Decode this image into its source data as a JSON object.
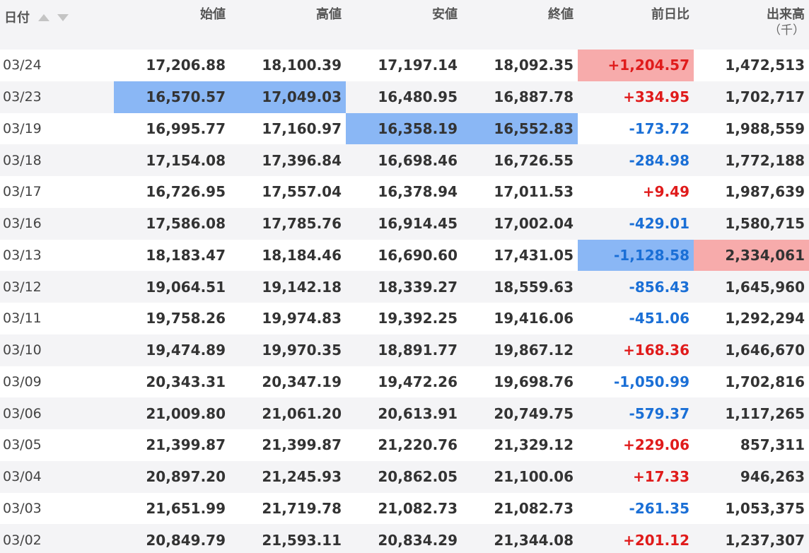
{
  "header": {
    "date": "日付",
    "open": "始値",
    "high": "高値",
    "low": "安値",
    "close": "終値",
    "change": "前日比",
    "volume": "出来高",
    "volume_unit": "（千）"
  },
  "colors": {
    "up": "#e01b1b",
    "down": "#1a6fd6",
    "highlight_blue": "#8ab7f5",
    "highlight_red": "#f7abab",
    "row_alt": "#f4f4f6"
  },
  "rows": [
    {
      "date": "03/24",
      "open": "17,206.88",
      "high": "18,100.39",
      "low": "17,197.14",
      "close": "18,092.35",
      "change": "+1,204.57",
      "volume": "1,472,513"
    },
    {
      "date": "03/23",
      "open": "16,570.57",
      "high": "17,049.03",
      "low": "16,480.95",
      "close": "16,887.78",
      "change": "+334.95",
      "volume": "1,702,717"
    },
    {
      "date": "03/19",
      "open": "16,995.77",
      "high": "17,160.97",
      "low": "16,358.19",
      "close": "16,552.83",
      "change": "-173.72",
      "volume": "1,988,559"
    },
    {
      "date": "03/18",
      "open": "17,154.08",
      "high": "17,396.84",
      "low": "16,698.46",
      "close": "16,726.55",
      "change": "-284.98",
      "volume": "1,772,188"
    },
    {
      "date": "03/17",
      "open": "16,726.95",
      "high": "17,557.04",
      "low": "16,378.94",
      "close": "17,011.53",
      "change": "+9.49",
      "volume": "1,987,639"
    },
    {
      "date": "03/16",
      "open": "17,586.08",
      "high": "17,785.76",
      "low": "16,914.45",
      "close": "17,002.04",
      "change": "-429.01",
      "volume": "1,580,715"
    },
    {
      "date": "03/13",
      "open": "18,183.47",
      "high": "18,184.46",
      "low": "16,690.60",
      "close": "17,431.05",
      "change": "-1,128.58",
      "volume": "2,334,061"
    },
    {
      "date": "03/12",
      "open": "19,064.51",
      "high": "19,142.18",
      "low": "18,339.27",
      "close": "18,559.63",
      "change": "-856.43",
      "volume": "1,645,960"
    },
    {
      "date": "03/11",
      "open": "19,758.26",
      "high": "19,974.83",
      "low": "19,392.25",
      "close": "19,416.06",
      "change": "-451.06",
      "volume": "1,292,294"
    },
    {
      "date": "03/10",
      "open": "19,474.89",
      "high": "19,970.35",
      "low": "18,891.77",
      "close": "19,867.12",
      "change": "+168.36",
      "volume": "1,646,670"
    },
    {
      "date": "03/09",
      "open": "20,343.31",
      "high": "20,347.19",
      "low": "19,472.26",
      "close": "19,698.76",
      "change": "-1,050.99",
      "volume": "1,702,816"
    },
    {
      "date": "03/06",
      "open": "21,009.80",
      "high": "21,061.20",
      "low": "20,613.91",
      "close": "20,749.75",
      "change": "-579.37",
      "volume": "1,117,265"
    },
    {
      "date": "03/05",
      "open": "21,399.87",
      "high": "21,399.87",
      "low": "21,220.76",
      "close": "21,329.12",
      "change": "+229.06",
      "volume": "857,311"
    },
    {
      "date": "03/04",
      "open": "20,897.20",
      "high": "21,245.93",
      "low": "20,862.05",
      "close": "21,100.06",
      "change": "+17.33",
      "volume": "946,263"
    },
    {
      "date": "03/03",
      "open": "21,651.99",
      "high": "21,719.78",
      "low": "21,082.73",
      "close": "21,082.73",
      "change": "-261.35",
      "volume": "1,053,375"
    },
    {
      "date": "03/02",
      "open": "20,849.79",
      "high": "21,593.11",
      "low": "20,834.29",
      "close": "21,344.08",
      "change": "+201.12",
      "volume": "1,237,307"
    }
  ]
}
